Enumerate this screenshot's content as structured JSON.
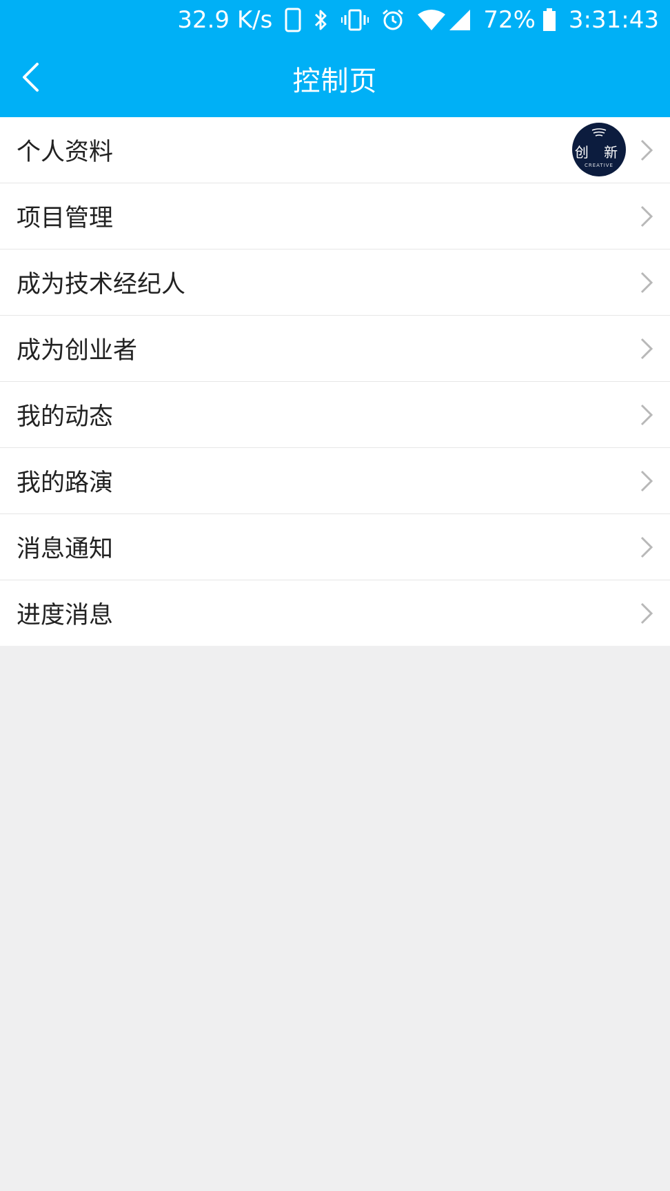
{
  "status_bar": {
    "net_speed": "32.9 K/s",
    "battery": "72%",
    "time": "3:31:43",
    "icons": [
      "phone-icon",
      "bluetooth-icon",
      "vibrate-icon",
      "alarm-icon",
      "wifi-icon",
      "signal-icon",
      "battery-icon"
    ]
  },
  "header": {
    "title": "控制页",
    "back_icon": "chevron-left-icon"
  },
  "menu": {
    "items": [
      {
        "label": "个人资料"
      },
      {
        "label": "项目管理"
      },
      {
        "label": "成为技术经纪人"
      },
      {
        "label": "成为创业者"
      },
      {
        "label": "我的动态"
      },
      {
        "label": "我的路演"
      },
      {
        "label": "消息通知"
      },
      {
        "label": "进度消息"
      }
    ],
    "avatar": {
      "text": "创 新",
      "subtext": "CREATIVE"
    }
  },
  "colors": {
    "accent": "#00b0f6",
    "background": "#efeff0",
    "row_bg": "#ffffff",
    "text": "#222222",
    "chevron": "#b8b8b8"
  }
}
